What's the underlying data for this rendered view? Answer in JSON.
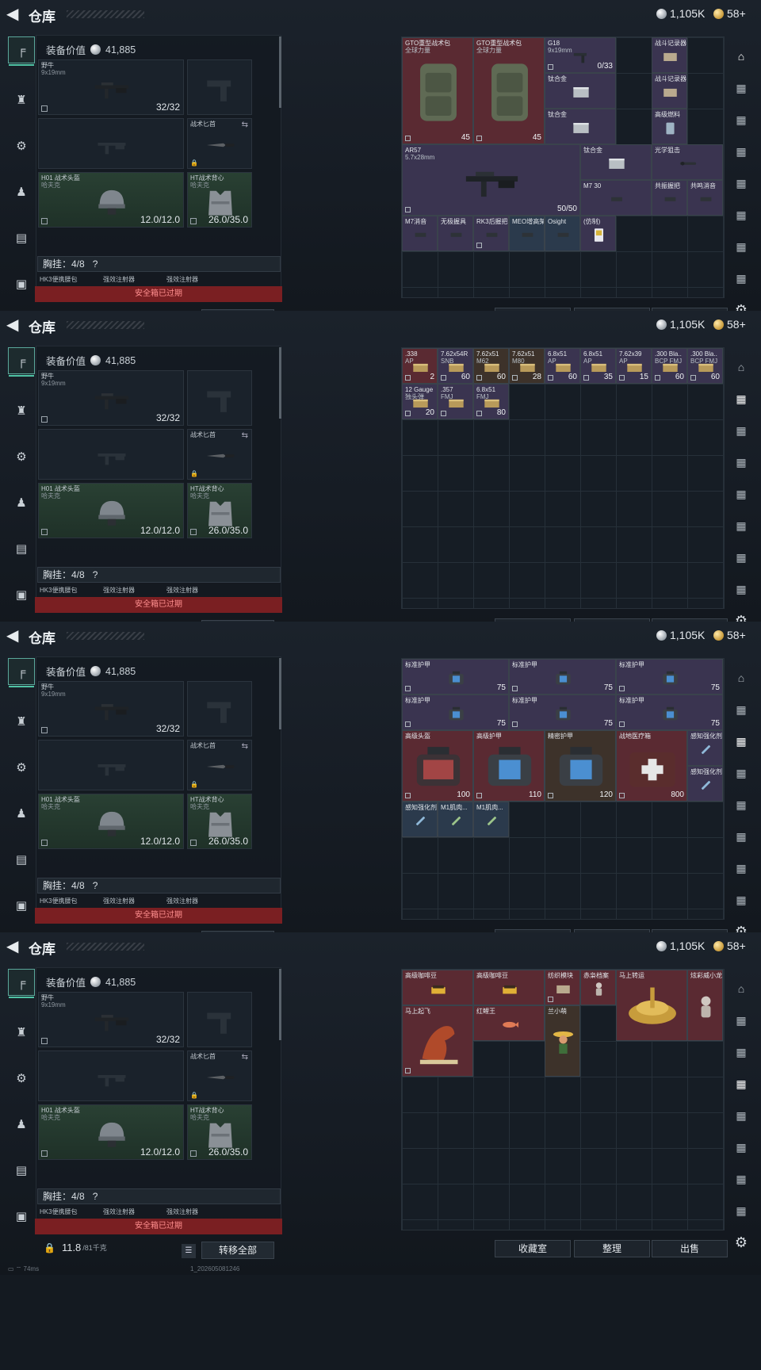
{
  "app": {
    "title": "仓库",
    "currency_silver": "1,105K",
    "currency_gold": "58+"
  },
  "loadout": {
    "value_label": "装备价值",
    "value": "41,885",
    "weapon1_name": "野牛",
    "weapon1_ammo": "9x19mm",
    "weapon1_count": "32/32",
    "knife_name": "战术匕首",
    "helmet_name": "H01 战术头盔",
    "helmet_brand": "哈夫克",
    "helmet_dur": "12.0/12.0",
    "armor_name": "HT战术背心",
    "armor_brand": "哈夫克",
    "armor_dur": "26.0/35.0",
    "chest_label": "胸挂：4/8",
    "chest_help": "?",
    "hk_items": [
      "HK3便携腰包",
      "强效注射器",
      "强效注射器"
    ],
    "banner": "安全箱已过期",
    "weight": "11.8",
    "weight_unit": "/81千克",
    "transfer_all": "转移全部"
  },
  "bottom": {
    "collection": "收藏室",
    "sort": "整理",
    "sell": "出售"
  },
  "status": {
    "ping": "74ms",
    "stamp": "1_202605081246"
  },
  "tabs": [
    {
      "items": [
        {
          "t": "GTO重型战术包",
          "t2": "全球力量",
          "q": "45"
        },
        {
          "t": "GTO重型战术包",
          "t2": "全球力量",
          "q": "45"
        },
        {
          "t": "G18",
          "t2": "9x19mm",
          "q": "0/33"
        },
        {
          "t": "战斗记录器",
          "t2": "",
          "q": ""
        },
        {
          "t": "钛合金",
          "t2": "",
          "q": ""
        },
        {
          "t": "战斗记录器",
          "t2": "",
          "q": ""
        },
        {
          "t": "钛合金",
          "t2": "",
          "q": ""
        },
        {
          "t": "高级燃料",
          "t2": "",
          "q": ""
        },
        {
          "t": "AR57",
          "t2": "5.7x28mm",
          "q": "50/50"
        },
        {
          "t": "钛合金",
          "t2": "",
          "q": ""
        },
        {
          "t": "光学狙击",
          "t2": "",
          "q": ""
        },
        {
          "t": "M7 30",
          "t2": "",
          "q": ""
        },
        {
          "t": "共振握把",
          "t2": "",
          "q": ""
        },
        {
          "t": "共鸣消音",
          "t2": "",
          "q": ""
        },
        {
          "t": "M7消音",
          "t2": "",
          "q": ""
        },
        {
          "t": "无极握具",
          "t2": "",
          "q": ""
        },
        {
          "t": "RK3后握把",
          "t2": "",
          "q": ""
        },
        {
          "t": "MEO增高架",
          "t2": "",
          "q": ""
        },
        {
          "t": "Osight",
          "t2": "",
          "q": ""
        },
        {
          "t": "(仿制)",
          "t2": "",
          "q": ""
        }
      ]
    },
    {
      "items": [
        {
          "t": ".338",
          "t2": "AP",
          "q": "2"
        },
        {
          "t": "7.62x54R",
          "t2": "SNB",
          "q": "60"
        },
        {
          "t": "7.62x51",
          "t2": "M62",
          "q": "60"
        },
        {
          "t": "7.62x51",
          "t2": "M80",
          "q": "28"
        },
        {
          "t": "6.8x51",
          "t2": "AP",
          "q": "60"
        },
        {
          "t": "6.8x51",
          "t2": "AP",
          "q": "35"
        },
        {
          "t": "7.62x39",
          "t2": "AP",
          "q": "15"
        },
        {
          "t": ".300 Bla..",
          "t2": "BCP FMJ",
          "q": "60"
        },
        {
          "t": ".300 Bla..",
          "t2": "BCP FMJ",
          "q": "60"
        },
        {
          "t": "12 Gauge",
          "t2": "独头弹",
          "q": "20"
        },
        {
          "t": ".357",
          "t2": "FMJ",
          "q": ""
        },
        {
          "t": "6.8x51",
          "t2": "FMJ",
          "q": "80"
        }
      ]
    },
    {
      "items": [
        {
          "t": "标准护甲",
          "q": "75"
        },
        {
          "t": "标准护甲",
          "q": "75"
        },
        {
          "t": "标准护甲",
          "q": "75"
        },
        {
          "t": "标准护甲",
          "q": "75"
        },
        {
          "t": "标准护甲",
          "q": "75"
        },
        {
          "t": "标准护甲",
          "q": "75"
        },
        {
          "t": "高级头盔",
          "q": "100"
        },
        {
          "t": "高级护甲",
          "q": "110"
        },
        {
          "t": "精密护甲",
          "q": "120"
        },
        {
          "t": "战地医疗箱",
          "q": "800"
        },
        {
          "t": "感知强化剂",
          "q": ""
        },
        {
          "t": "感知强化剂",
          "q": ""
        },
        {
          "t": "感知强化剂",
          "q": ""
        },
        {
          "t": "M1肌肉...",
          "q": ""
        },
        {
          "t": "M1肌肉...",
          "q": ""
        }
      ]
    },
    {
      "items": [
        {
          "t": "高级咖啡豆"
        },
        {
          "t": "高级咖啡豆"
        },
        {
          "t": "纺织模块"
        },
        {
          "t": "赤枭档案"
        },
        {
          "t": "马上转运"
        },
        {
          "t": "炫彩威小龙"
        },
        {
          "t": "马上起飞"
        },
        {
          "t": "红鲤王"
        },
        {
          "t": "兰小萌"
        }
      ]
    }
  ],
  "colors": {
    "accent": "#4fc3a4",
    "red_cell": "#5a2a32",
    "purple_cell": "#3a3450",
    "banner": "#7a1f22"
  }
}
